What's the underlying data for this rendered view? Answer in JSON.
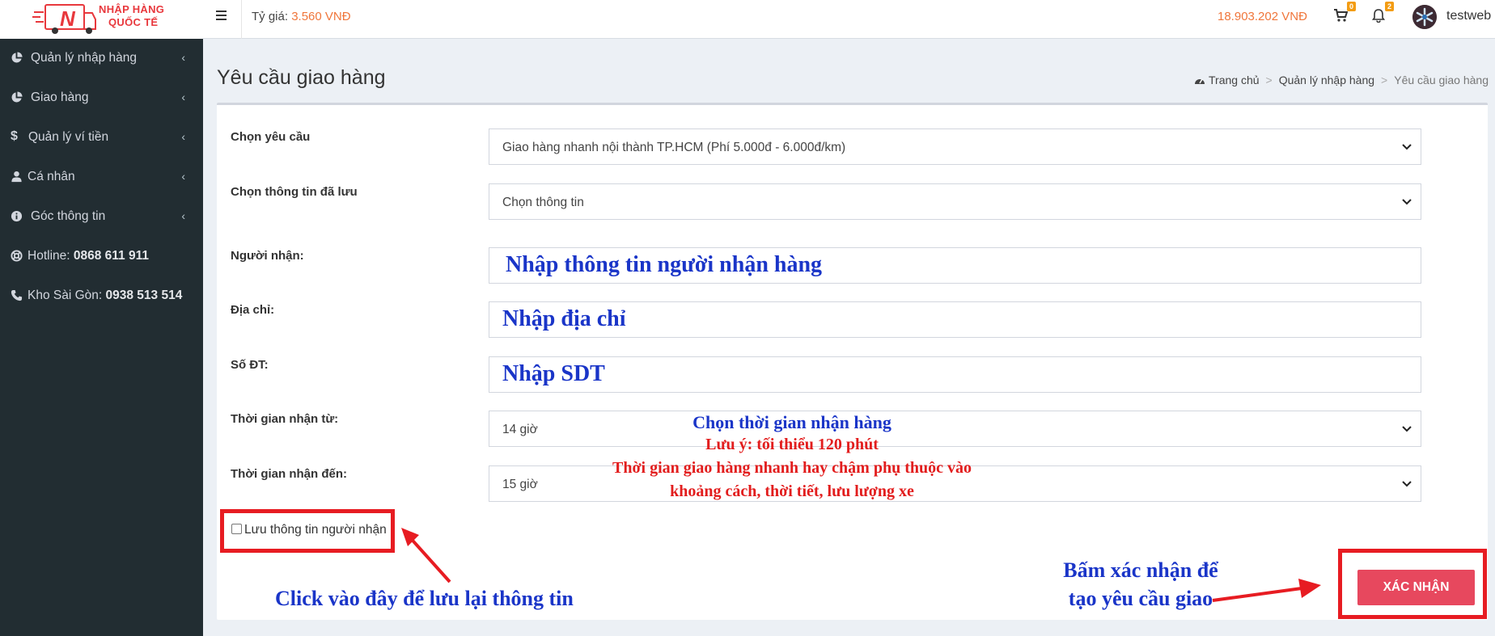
{
  "brand": {
    "line1": "NHẬP HÀNG",
    "line2": "QUỐC TẾ",
    "mark": "N"
  },
  "header": {
    "rate_label": "Tỷ giá:",
    "rate_value": "3.560 VNĐ",
    "balance": "18.903.202 VNĐ",
    "cart_count": "0",
    "notif_count": "2",
    "username": "testweb"
  },
  "sidebar": {
    "items": [
      {
        "label": "Quản lý nhập hàng",
        "icon": "pie-chart-icon"
      },
      {
        "label": "Giao hàng",
        "icon": "pie-chart-icon"
      },
      {
        "label": "Quản lý ví tiền",
        "icon": "dollar-icon"
      },
      {
        "label": "Cá nhân",
        "icon": "user-icon"
      },
      {
        "label": "Góc thông tin",
        "icon": "info-icon"
      }
    ],
    "hotline_label": "Hotline:",
    "hotline_number": "0868 611 911",
    "kho_label": "Kho Sài Gòn:",
    "kho_number": "0938 513 514"
  },
  "page": {
    "title": "Yêu cầu giao hàng",
    "breadcrumb": [
      "Trang chủ",
      "Quản lý nhập hàng",
      "Yêu cầu giao hàng"
    ]
  },
  "form": {
    "request_label": "Chọn yêu cầu",
    "request_value": "Giao hàng nhanh nội thành TP.HCM (Phí 5.000đ - 6.000đ/km)",
    "saved_label": "Chọn thông tin đã lưu",
    "saved_value": "Chọn thông tin",
    "receiver_label": "Người nhận:",
    "address_label": "Địa chỉ:",
    "phone_label": "Số ĐT:",
    "time_from_label": "Thời gian nhận từ:",
    "time_from_value": "14 giờ",
    "time_to_label": "Thời gian nhận đến:",
    "time_to_value": "15 giờ",
    "save_info_label": "Lưu thông tin người nhận",
    "confirm_label": "XÁC NHẬN"
  },
  "annotations": {
    "receiver": "Nhập thông tin người nhận hàng",
    "address": "Nhập địa chỉ",
    "phone": "Nhập SDT",
    "time_title": "Chọn thời gian nhận hàng",
    "time_note": "Lưu ý: tối thiểu 120 phút",
    "speed_note_1": "Thời gian giao hàng nhanh hay chậm phụ thuộc vào",
    "speed_note_2": "khoảng cách, thời tiết, lưu lượng xe",
    "save_hint": "Click vào đây để lưu lại thông tin",
    "confirm_hint_1": "Bấm xác nhận để",
    "confirm_hint_2": "tạo yêu cầu giao"
  },
  "colors": {
    "sidebar_bg": "#222d32",
    "accent_orange": "#f0763b",
    "confirm_button": "#e7485e",
    "annotation_red": "#e71c22",
    "annotation_blue": "#1a35c8"
  }
}
